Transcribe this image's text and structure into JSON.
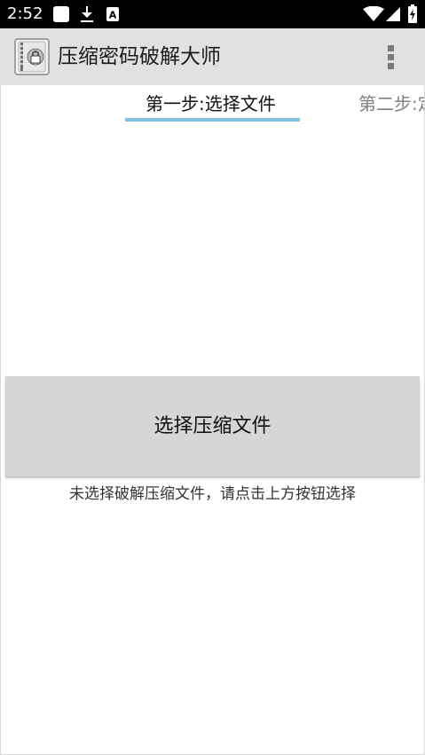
{
  "status_bar": {
    "time": "2:52",
    "left_icons": [
      "square-notification-icon",
      "download-icon",
      "a-box-icon"
    ],
    "right_icons": [
      "wifi-icon",
      "cell-signal-icon",
      "battery-icon"
    ],
    "background": "#000000"
  },
  "app_bar": {
    "title": "压缩密码破解大师",
    "logo_icon": "zip-lock-icon",
    "menu_icon": "overflow-menu-icon",
    "background": "#e1e1e1"
  },
  "tabs": [
    {
      "label": "第一步:选择文件",
      "selected": true
    },
    {
      "label": "第二步:定",
      "selected": false
    }
  ],
  "tab_indicator_color": "#7ec4e2",
  "main": {
    "select_button_label": "选择压缩文件",
    "hint": "未选择破解压缩文件，请点击上方按钮选择"
  }
}
